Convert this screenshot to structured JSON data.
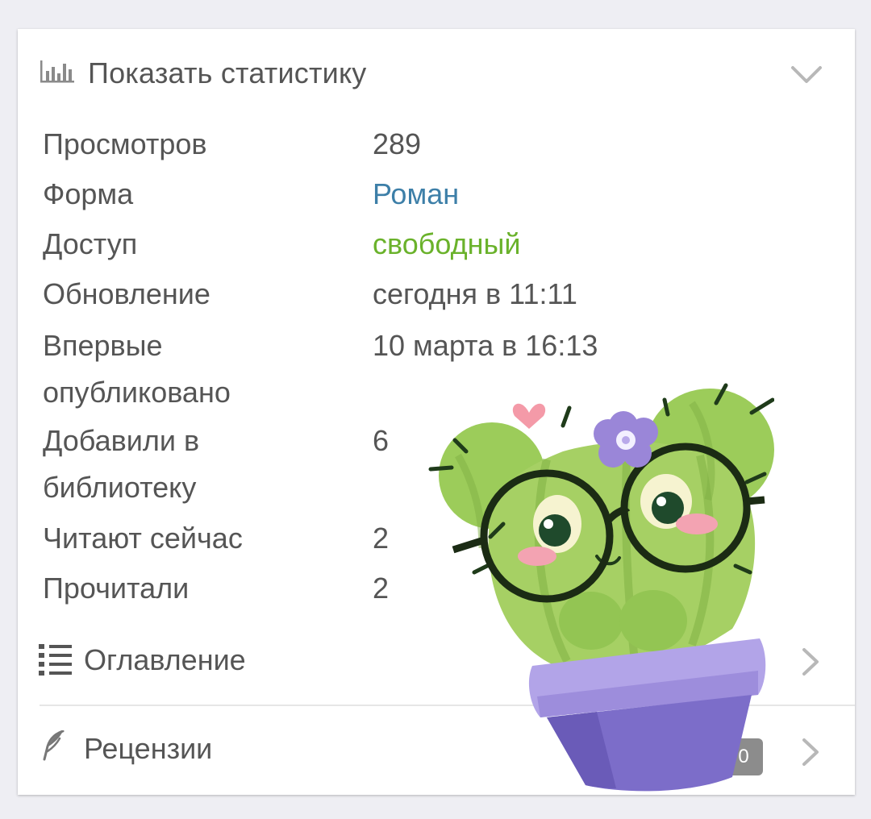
{
  "stats_header": {
    "title": "Показать статистику",
    "icon": "bar-chart-icon",
    "toggle_icon": "chevron-down-icon"
  },
  "stats": [
    {
      "label": "Просмотров",
      "value": "289"
    },
    {
      "label": "Форма",
      "value": "Роман"
    },
    {
      "label": "Доступ",
      "value": "свободный"
    },
    {
      "label": "Обновление",
      "value": "сегодня в 11:11"
    },
    {
      "label": "Впервые опубликовано",
      "value": "10 марта в 16:13"
    },
    {
      "label": "Добавили в библиотеку",
      "value": "6"
    },
    {
      "label": "Читают сейчас",
      "value": "2"
    },
    {
      "label": "Прочитали",
      "value": "2"
    }
  ],
  "menu": {
    "contents": {
      "label": "Оглавление",
      "icon": "list-icon",
      "arrow_icon": "chevron-right-icon"
    },
    "reviews": {
      "label": "Рецензии",
      "icon": "feather-icon",
      "count": "0",
      "arrow_icon": "chevron-right-icon"
    }
  },
  "colors": {
    "text": "#555555",
    "link": "#3d7fa8",
    "access_free": "#6ab22b",
    "badge": "#8c8c8c",
    "background": "#eeeef3"
  },
  "decoration": {
    "sticker": "cactus-with-glasses-sticker"
  }
}
